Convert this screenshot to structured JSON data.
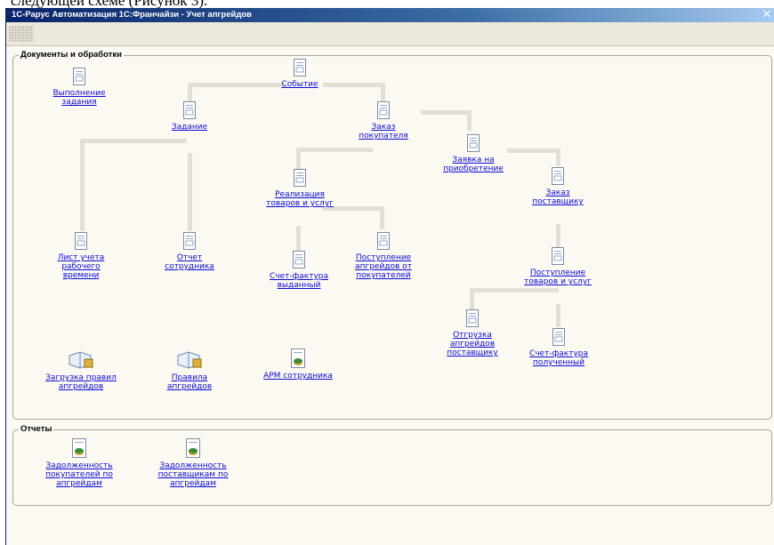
{
  "caption": "следующей схеме (Рисунок 3).",
  "window": {
    "title": "1С-Рарус Автоматизация 1С:Франчайзи - Учет апгрейдов",
    "close": "✕"
  },
  "groups": {
    "documents": "Документы и обработки",
    "reports": "Отчеты"
  },
  "nodes": {
    "vypolnenie": "Выполнение\nзадания",
    "sobytie": "Событие",
    "zadanie": "Задание",
    "zakaz_pokupatelya": "Заказ\nпокупателя",
    "zayavka": "Заявка на\nприобретение",
    "zakaz_postavshchiku": "Заказ\nпоставщику",
    "realizaciya": "Реализация\nтоваров и услуг",
    "list_ucheta": "Лист учета\nрабочего\nвремени",
    "otchet_sotrudnika": "Отчет\nсотрудника",
    "schet_faktura_vydannyj": "Счет-фактура\nвыданный",
    "postuplenie_apgrejdov": "Поступление\nапгрейдов от\nпокупателей",
    "postuplenie_tovarov": "Поступление\nтоваров и услуг",
    "otgruzka": "Отгрузка\nапгрейдов\nпоставщику",
    "schet_faktura_poluchennyj": "Счет-фактура\nполученный",
    "zagruzka_pravil": "Загрузка правил\nапгрейдов",
    "pravila": "Правила\nапгрейдов",
    "arm": "АРМ сотрудника",
    "zadolzhennost_pokupatelej": "Задолженность\nпокупателей по\nапгрейдам",
    "zadolzhennost_postavshchikam": "Задолженность\nпоставщикам по\nапгрейдам"
  }
}
